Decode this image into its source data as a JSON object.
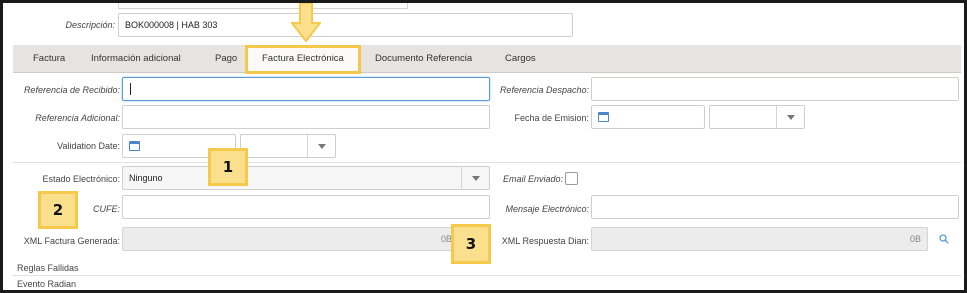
{
  "top": {
    "descripcion_label": "Descripción:",
    "descripcion_value": "BOK000008 | HAB 303"
  },
  "tabs": [
    {
      "label": "Factura"
    },
    {
      "label": "Información adicional"
    },
    {
      "label": "Pago"
    },
    {
      "label": "Factura Electrónica",
      "active": true
    },
    {
      "label": "Documento Referencia"
    },
    {
      "label": "Cargos"
    }
  ],
  "form": {
    "referencia_recibido_label": "Referencia de Recibido:",
    "referencia_recibido_value": "",
    "referencia_despacho_label": "Referencia Despacho:",
    "referencia_despacho_value": "",
    "referencia_adicional_label": "Referencia Adicional:",
    "referencia_adicional_value": "",
    "fecha_emision_label": "Fecha de Emision:",
    "validation_date_label": "Validation Date:",
    "estado_electronico_label": "Estado Electrónico:",
    "estado_electronico_value": "Ninguno",
    "email_enviado_label": "Email Enviado:",
    "cufe_label": "CUFE:",
    "cufe_value": "",
    "mensaje_electronico_label": "Mensaje Electrónico:",
    "mensaje_electronico_value": "",
    "xml_factura_label": "XML Factura Generada:",
    "xml_factura_size": "0B",
    "xml_respuesta_label": "XML Respuesta Dian:",
    "xml_respuesta_size": "0B",
    "reglas_fallidas_label": "Reglas Fallidas",
    "evento_radian_label": "Evento Radian"
  },
  "annotations": {
    "badge_1": "1",
    "badge_2": "2",
    "badge_3": "3"
  },
  "colors": {
    "highlight": "#f6c94c",
    "highlight_fill": "#fae08c",
    "tabbar": "#e6e3e1",
    "focus_border": "#5b9bd5",
    "calendar_icon": "#4a86c8"
  }
}
